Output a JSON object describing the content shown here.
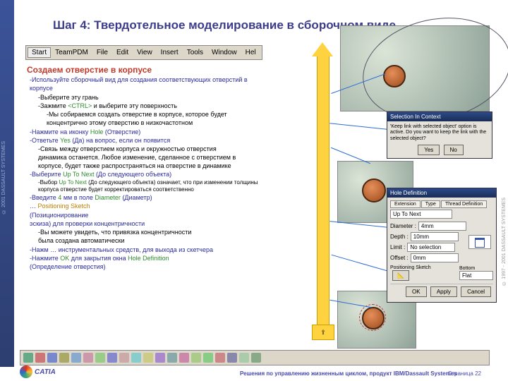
{
  "title": "Шаг 4: Твердотельное моделирование в сборочном виде",
  "subtitle": "Создаем отверстие в корпусе",
  "side_left": "© 2001 DASSAULT SYSTEMES",
  "side_right": "© 1997 - 2001 DASSAULT SYSTEMES",
  "menu": {
    "start": "Start",
    "items": [
      "TeamPDM",
      "File",
      "Edit",
      "View",
      "Insert",
      "Tools",
      "Window",
      "Hel"
    ]
  },
  "lines": {
    "l1": "-Используйте сборочный вид для создания соответствующих отверстий в",
    "l1b": "корпусе",
    "l2": "-Выберите эту грань",
    "l3a": "-Зажмите ",
    "l3k": "<CTRL>",
    "l3b": " и выберите эту поверхность",
    "l4": "-Мы собираемся создать отверстие в корпусе, которое будет",
    "l4b": "концентрично этому отверстию в низкочастотном",
    "l5a": "-Нажмите на иконку ",
    "l5k": "Hole",
    "l5b": " (Отверстие)",
    "l6a": "-Ответьте ",
    "l6k": "Yes",
    "l6b": " (Да) на вопрос, если он появится",
    "l7": "-Связь между отверстием корпуса и окружностью отверстия",
    "l7b": "динамика останется. Любое изменение, сделанное с отверстием в корпусе, будет также распространяться на отверстие в динамике",
    "l8a": "-Выберите ",
    "l8k": "Up To Next",
    "l8b": " (До следующего объекта)",
    "l9a": "-Выбор ",
    "l9k": "Up To Next",
    "l9b": " (До следующего объекта) означает, что при изменении толщины корпуса отверстие будет корректироваться соответственно",
    "l10a": "-Введите ",
    "l10v": "4",
    "l10b": " мм в поле ",
    "l10k": "Diameter",
    "l10c": " (Диаметр)",
    "l11a": "… ",
    "l11k": "Positioning Sketch",
    "l12": "(Позиционирование",
    "l12b": "эскиза) для проверки концентричности",
    "l13": "-Вы можете увидеть, что привязка концентричности",
    "l13b": "была создана автоматически",
    "l14": "-Нажм … инструментальных средств, для выхода из скетчера",
    "l15a": "-Нажмите ",
    "l15k": "OK",
    "l15b": " для закрытия окна ",
    "l15k2": "Hole Definition",
    "l15c": "(Определение отверстия)"
  },
  "dlg_sel": {
    "title": "Selection In Context",
    "msg": "'Keep link with selected object' option is active.\nDo you want to keep the link with the selected object?",
    "yes": "Yes",
    "no": "No"
  },
  "dlg_hole": {
    "title": "Hole Definition",
    "tabs": [
      "Extension",
      "Type",
      "Thread Definition"
    ],
    "ext": "Up To Next",
    "diam_lbl": "Diameter :",
    "diam": "4mm",
    "depth_lbl": "Depth :",
    "depth": "10mm",
    "limit_lbl": "Limit :",
    "limit": "No selection",
    "offset_lbl": "Offset :",
    "offset": "0mm",
    "ps": "Positioning Sketch",
    "bottom_lbl": "Bottom",
    "bottom": "Flat",
    "ok": "OK",
    "apply": "Apply",
    "cancel": "Cancel"
  },
  "footer": {
    "brand": "CATIA",
    "text": "Решения по управлению жизненным циклом, продукт IBM/Dassault Systemes",
    "page_label": "Страница",
    "page_no": "22"
  }
}
